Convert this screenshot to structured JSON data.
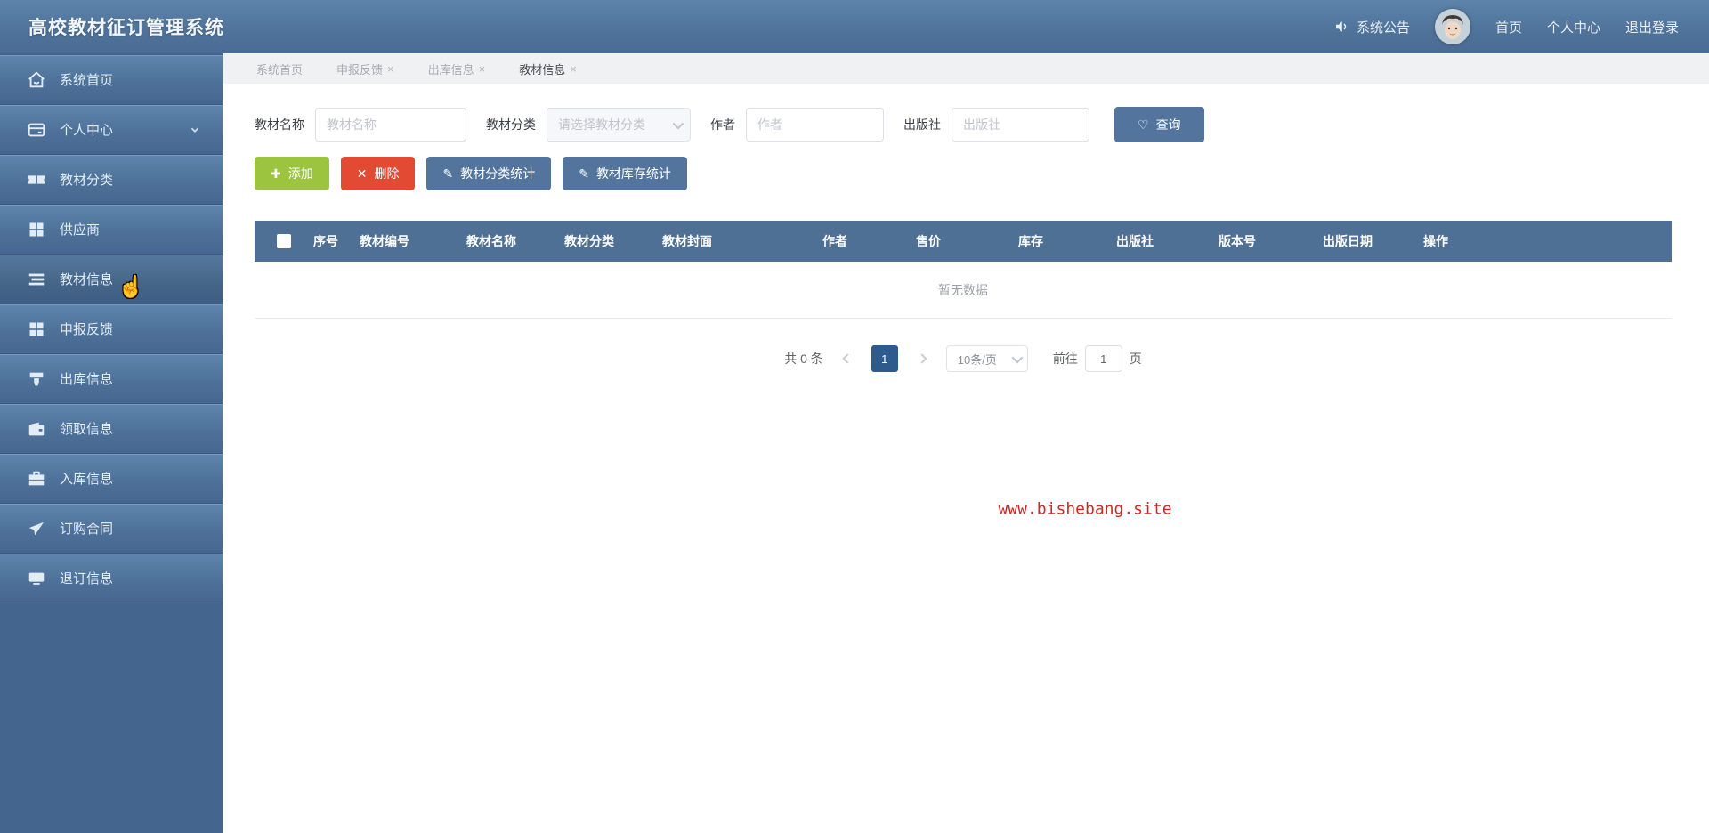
{
  "header": {
    "title": "高校教材征订管理系统",
    "announcement": "系统公告",
    "nav_home": "首页",
    "nav_profile": "个人中心",
    "nav_logout": "退出登录"
  },
  "sidebar": {
    "items": [
      {
        "label": "系统首页",
        "icon": "home-icon",
        "active": false
      },
      {
        "label": "个人中心",
        "icon": "postcard-icon",
        "active": false,
        "has_chevron": true
      },
      {
        "label": "教材分类",
        "icon": "ticket-icon",
        "active": false
      },
      {
        "label": "供应商",
        "icon": "grid-icon",
        "active": false
      },
      {
        "label": "教材信息",
        "icon": "list-icon",
        "active": true
      },
      {
        "label": "申报反馈",
        "icon": "grid-icon",
        "active": false
      },
      {
        "label": "出库信息",
        "icon": "outbox-icon",
        "active": false
      },
      {
        "label": "领取信息",
        "icon": "wallet-icon",
        "active": false
      },
      {
        "label": "入库信息",
        "icon": "suitcase-icon",
        "active": false
      },
      {
        "label": "订购合同",
        "icon": "send-icon",
        "active": false
      },
      {
        "label": "退订信息",
        "icon": "monitor-icon",
        "active": false
      }
    ]
  },
  "tabs": [
    {
      "label": "系统首页",
      "close": "",
      "active": false
    },
    {
      "label": "申报反馈",
      "close": "×",
      "active": false
    },
    {
      "label": "出库信息",
      "close": "×",
      "active": false
    },
    {
      "label": "教材信息",
      "close": "×",
      "active": true
    }
  ],
  "search_form": {
    "fields": [
      {
        "label": "教材名称",
        "placeholder": "教材名称",
        "type": "input"
      },
      {
        "label": "教材分类",
        "placeholder": "请选择教材分类",
        "type": "select"
      },
      {
        "label": "作者",
        "placeholder": "作者",
        "type": "input"
      },
      {
        "label": "出版社",
        "placeholder": "出版社",
        "type": "input"
      }
    ],
    "query_label": "查询",
    "query_icon": "heart-icon"
  },
  "toolbar": {
    "add_label": "添加",
    "add_icon": "plus-icon",
    "delete_label": "删除",
    "delete_icon": "close-icon",
    "category_stats_label": "教材分类统计",
    "stock_stats_label": "教材库存统计",
    "stats_icon": "pencil-icon"
  },
  "table": {
    "columns": [
      "序号",
      "教材编号",
      "教材名称",
      "教材分类",
      "教材封面",
      "作者",
      "售价",
      "库存",
      "出版社",
      "版本号",
      "出版日期",
      "操作"
    ],
    "empty_text": "暂无数据"
  },
  "pagination": {
    "total_text": "共 0 条",
    "current_page": "1",
    "page_size": "10条/页",
    "goto_label": "前往",
    "goto_value": "1",
    "goto_suffix": "页"
  },
  "watermark": "www.bishebang.site",
  "colors": {
    "topbar_blue": "#4f7299",
    "sidebar_blue": "#44658d",
    "table_header_blue": "#4e7095",
    "primary_button_blue": "#53759d",
    "add_green": "#9cc43e",
    "delete_red": "#e24a33",
    "pager_active_blue": "#2e5b8e",
    "watermark_red": "#cb2a26"
  }
}
